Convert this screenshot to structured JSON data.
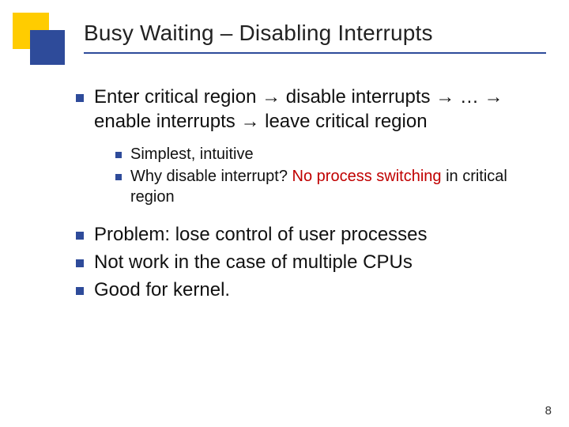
{
  "title": "Busy Waiting – Disabling Interrupts",
  "main": {
    "bullet1_a": "Enter critical region ",
    "bullet1_b": " disable interrupts ",
    "bullet1_c": " … ",
    "bullet1_d": " enable interrupts ",
    "bullet1_e": " leave critical region"
  },
  "sub": {
    "s1": "Simplest, intuitive",
    "s2a": "Why disable interrupt? ",
    "s2b_red": "No process switching",
    "s2c": " in critical region"
  },
  "lower": {
    "l1": "Problem: lose control of user processes",
    "l2": "Not work in the case of multiple CPUs",
    "l3": "Good for kernel."
  },
  "arrow": "→",
  "page": "8"
}
